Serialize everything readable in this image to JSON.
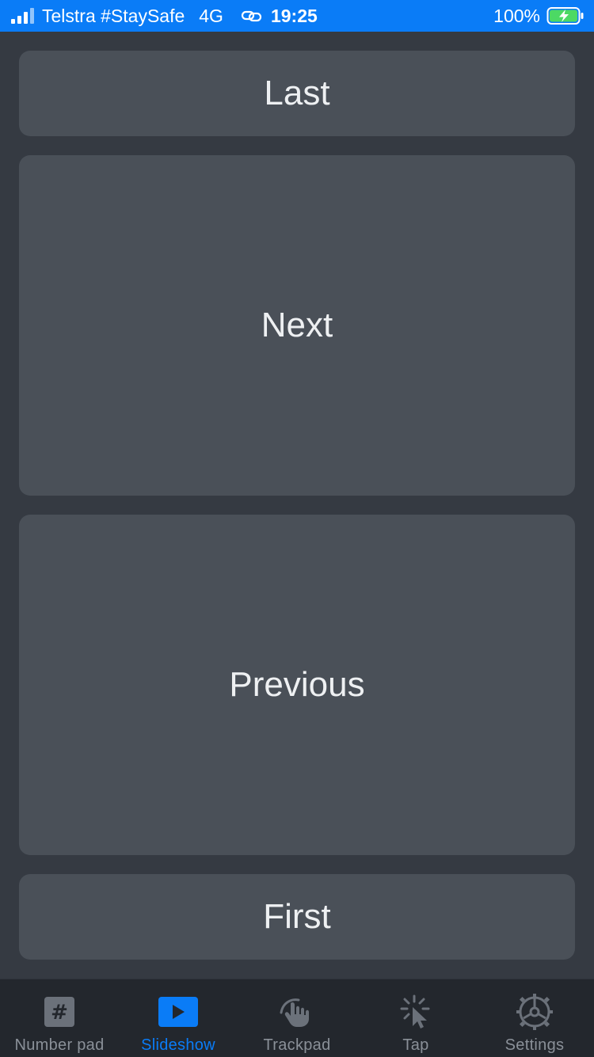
{
  "status_bar": {
    "carrier": "Telstra #StaySafe",
    "network": "4G",
    "time": "19:25",
    "battery_percent": "100%"
  },
  "buttons": {
    "last": "Last",
    "next": "Next",
    "previous": "Previous",
    "first": "First"
  },
  "tab_bar": {
    "tabs": [
      {
        "label": "Number pad",
        "icon": "hash-icon"
      },
      {
        "label": "Slideshow",
        "icon": "play-icon",
        "active": true
      },
      {
        "label": "Trackpad",
        "icon": "hand-touch-icon"
      },
      {
        "label": "Tap",
        "icon": "tap-cursor-icon"
      },
      {
        "label": "Settings",
        "icon": "gear-icon"
      }
    ]
  },
  "colors": {
    "status_bar": "#0a7cf7",
    "background": "#353a42",
    "button": "#4a5058",
    "tab_bar": "#23272d",
    "active_tab": "#0a7cf7",
    "inactive_tab": "#8a9098"
  }
}
